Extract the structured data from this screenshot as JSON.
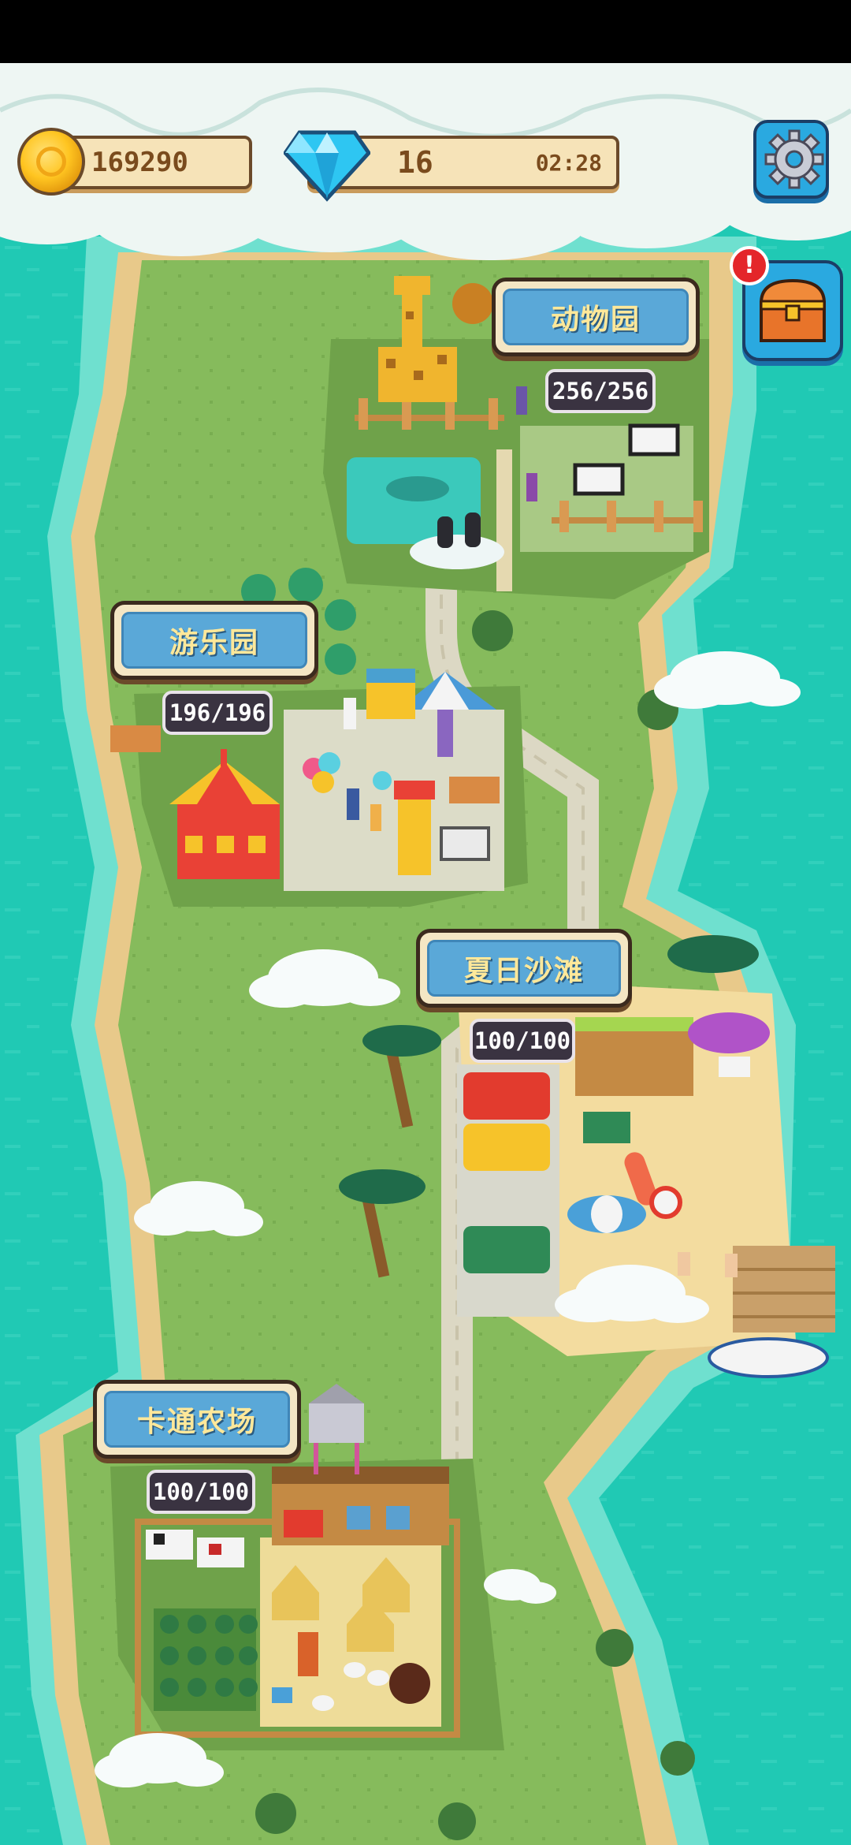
{
  "hud": {
    "coins": "169290",
    "gems": "16",
    "gem_timer": "02:28",
    "alert_mark": "!"
  },
  "areas": {
    "zoo": {
      "name": "动物园",
      "count": "256/256"
    },
    "amusement_park": {
      "name": "游乐园",
      "count": "196/196"
    },
    "summer_beach": {
      "name": "夏日沙滩",
      "count": "100/100"
    },
    "cartoon_farm": {
      "name": "卡通农场",
      "count": "100/100"
    }
  },
  "icons": {
    "currency": "coin-icon",
    "premium": "diamond-icon",
    "settings": "gear-icon",
    "reward": "treasure-chest-icon"
  },
  "colors": {
    "ocean": "#20c9b4",
    "grass": "#86bb5c",
    "sand": "#e8c98a",
    "sign_blue": "#5aa8d8",
    "sign_text": "#ffe89a",
    "alert_red": "#e4262a"
  }
}
